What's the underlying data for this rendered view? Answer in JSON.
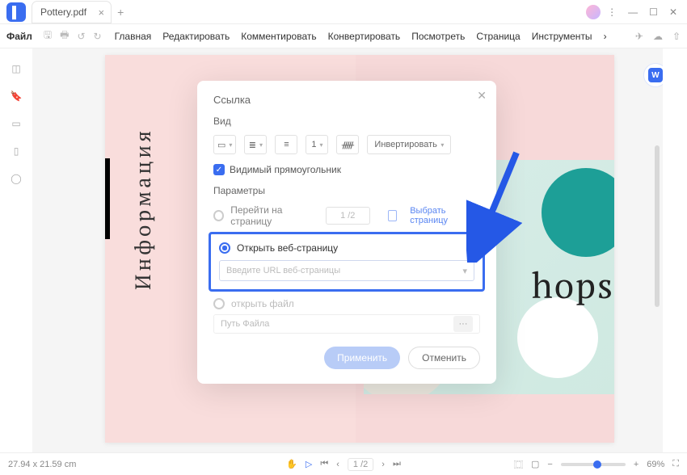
{
  "titlebar": {
    "tab_name": "Pottery.pdf",
    "add_glyph": "+",
    "close_glyph": "×",
    "more_glyph": "⋮",
    "min_glyph": "—",
    "max_glyph": "☐",
    "x_glyph": "✕"
  },
  "toolbar": {
    "menu_file": "Файл",
    "nav": [
      "Главная",
      "Редактировать",
      "Комментировать",
      "Конвертировать",
      "Посмотреть",
      "Страница",
      "Инструменты"
    ],
    "chevron": "›"
  },
  "doc": {
    "vertical_text": "Информация",
    "headline_fragment": "hops",
    "word_badge": "W"
  },
  "dialog": {
    "title": "Ссылка",
    "section_view": "Вид",
    "thickness_value": "1",
    "invert_label": "Инвертировать",
    "visible_rect": "Видимый прямоугольник",
    "section_params": "Параметры",
    "goto_page": "Перейти на страницу",
    "goto_page_value": "1 /2",
    "select_page": "Выбрать страницу",
    "open_web": "Открыть веб-страницу",
    "url_placeholder": "Введите URL веб-страницы",
    "open_file": "открыть файл",
    "path_placeholder": "Путь Файла",
    "more_dots": "···",
    "apply": "Применить",
    "cancel": "Отменить"
  },
  "status": {
    "dims": "27.94 x 21.59 cm",
    "page": "1 /2",
    "zoom": "69%",
    "minus": "−",
    "plus": "+"
  },
  "glyphs": {
    "caret": "▾",
    "check": "✓",
    "close": "✕"
  }
}
